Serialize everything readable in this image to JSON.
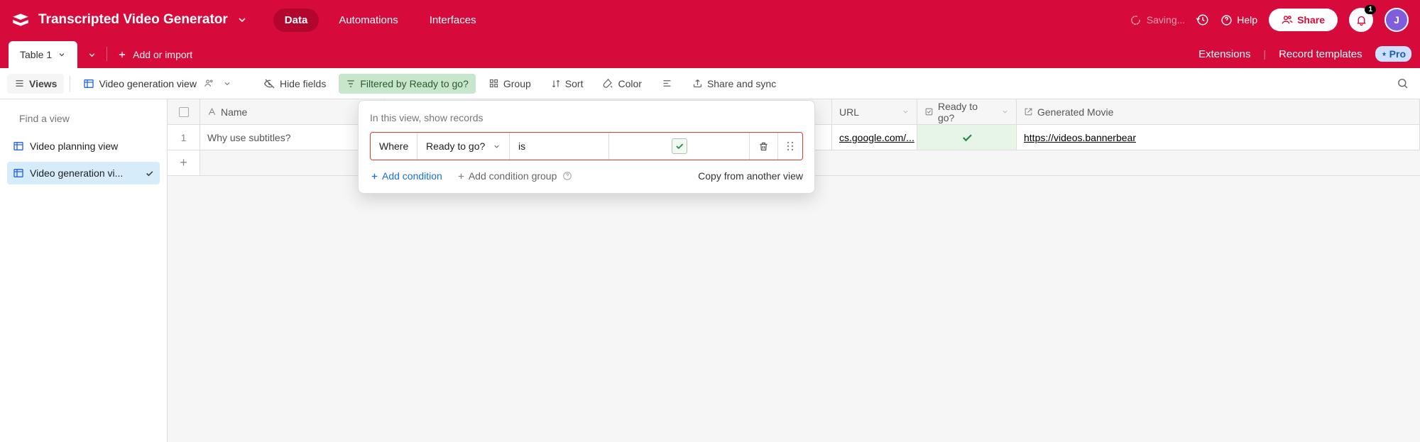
{
  "header": {
    "title": "Transcripted Video Generator",
    "tabs": {
      "data": "Data",
      "automations": "Automations",
      "interfaces": "Interfaces"
    },
    "saving": "Saving...",
    "help": "Help",
    "share": "Share",
    "notif_count": "1",
    "avatar_initial": "J"
  },
  "tablebar": {
    "table_name": "Table 1",
    "add_or_import": "Add or import",
    "extensions": "Extensions",
    "record_templates": "Record templates",
    "pro": "Pro"
  },
  "toolbar": {
    "views": "Views",
    "view_name": "Video generation view",
    "hide_fields": "Hide fields",
    "filter_label": "Filtered by Ready to go?",
    "group": "Group",
    "sort": "Sort",
    "color": "Color",
    "share_sync": "Share and sync"
  },
  "sidebar": {
    "search_placeholder": "Find a view",
    "items": [
      {
        "label": "Video planning view",
        "active": false
      },
      {
        "label": "Video generation vi...",
        "active": true
      }
    ]
  },
  "columns": {
    "name": "Name",
    "url": "URL",
    "ready": "Ready to go?",
    "generated": "Generated Movie"
  },
  "rows": [
    {
      "num": "1",
      "name": "Why use subtitles?",
      "url": "cs.google.com/...",
      "ready": true,
      "generated": "https://videos.bannerbear"
    }
  ],
  "filter": {
    "header": "In this view, show records",
    "where": "Where",
    "field": "Ready to go?",
    "operator": "is",
    "add_condition": "Add condition",
    "add_group": "Add condition group",
    "copy_from": "Copy from another view"
  }
}
